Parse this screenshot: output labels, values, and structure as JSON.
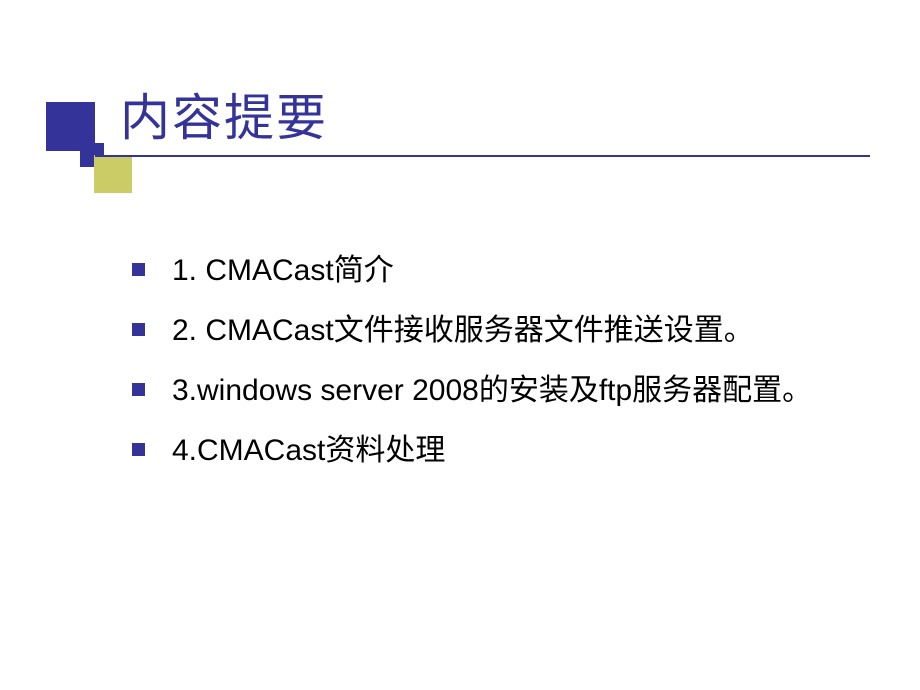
{
  "slide": {
    "title": "内容提要",
    "items": [
      "1. CMACast简介",
      "2. CMACast文件接收服务器文件推送设置。",
      "3.windows server 2008的安装及ftp服务器配置。",
      "4.CMACast资料处理"
    ]
  }
}
